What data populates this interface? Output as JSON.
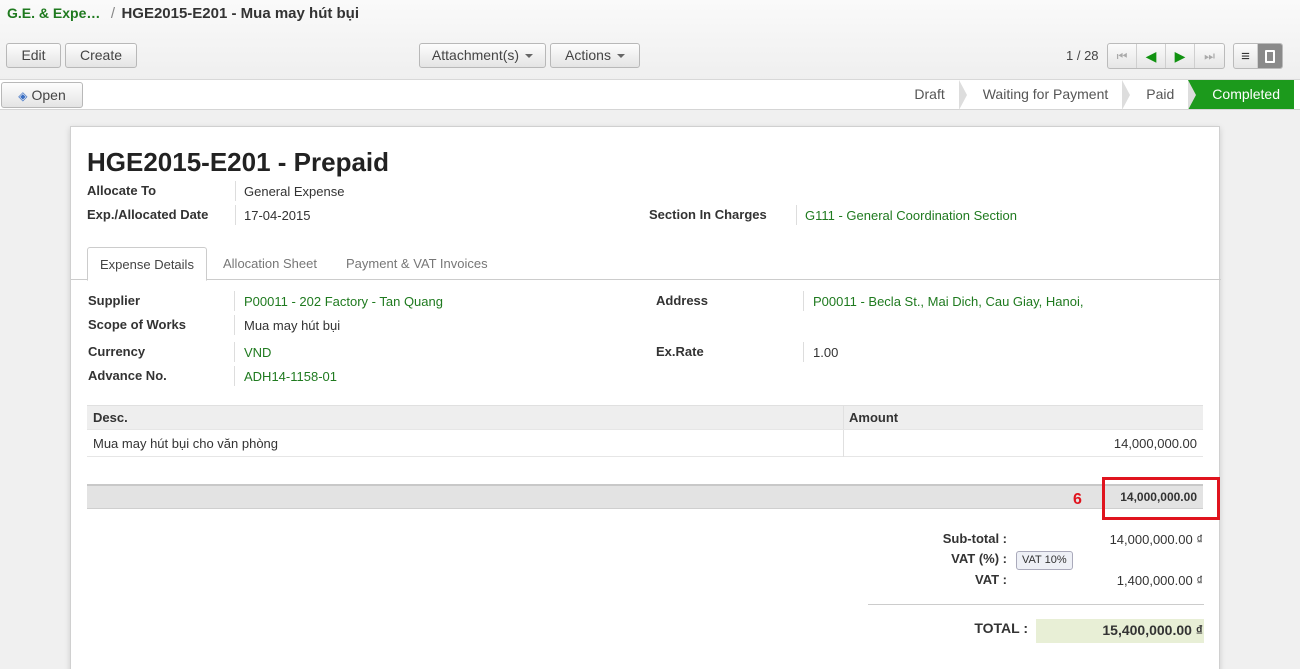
{
  "breadcrumb": {
    "parent": "G.E. & Expe…",
    "separator": "/",
    "current": "HGE2015-E201 - Mua may hút bụi"
  },
  "toolbar": {
    "edit": "Edit",
    "create": "Create",
    "attachments": "Attachment(s)",
    "actions": "Actions",
    "pager": "1 / 28"
  },
  "statusbar": {
    "open": "Open",
    "stages": [
      "Draft",
      "Waiting for Payment",
      "Paid",
      "Completed"
    ],
    "active_stage": "Completed"
  },
  "form": {
    "title": "HGE2015-E201 -  Prepaid",
    "allocate_to_label": "Allocate To",
    "allocate_to": "General Expense",
    "date_label": "Exp./Allocated Date",
    "date": "17-04-2015",
    "section_label": "Section In Charges",
    "section": "G111 - General Coordination Section"
  },
  "tabs": [
    "Expense Details",
    "Allocation Sheet",
    "Payment & VAT Invoices"
  ],
  "details": {
    "supplier_label": "Supplier",
    "supplier": "P00011 - 202 Factory - Tan Quang",
    "scope_label": "Scope of Works",
    "scope": "Mua may hút bụi",
    "currency_label": "Currency",
    "currency": "VND",
    "advance_label": "Advance No.",
    "advance": "ADH14-1158-01",
    "address_label": "Address",
    "address": "P00011 - Becla St., Mai Dich, Cau Giay, Hanoi,",
    "exrate_label": "Ex.Rate",
    "exrate": "1.00"
  },
  "lines": {
    "headers": {
      "desc": "Desc.",
      "amount": "Amount"
    },
    "rows": [
      {
        "desc": "Mua may hút bụi cho văn phòng",
        "amount": "14,000,000.00"
      }
    ],
    "footer_total": "14,000,000.00",
    "annotation": "6"
  },
  "totals": {
    "subtotal_label": "Sub-total :",
    "subtotal": "14,000,000.00 ₫",
    "vat_pct_label": "VAT (%) :",
    "vat_tag": "VAT 10%",
    "vat_label": "VAT :",
    "vat": "1,400,000.00 ₫",
    "total_label": "TOTAL :",
    "total": "15,400,000.00 ₫"
  },
  "colors": {
    "brand_green": "#1c9a1c",
    "link_green": "#1f7a1f",
    "highlight_red": "#e0141e"
  }
}
